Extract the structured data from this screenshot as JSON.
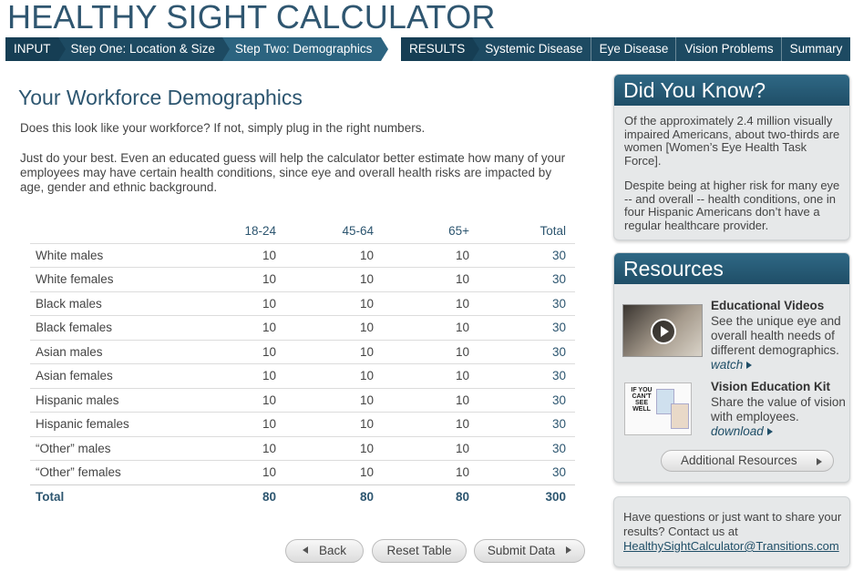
{
  "app_title": "HEALTHY SIGHT CALCULATOR",
  "nav": {
    "input_steps": [
      "INPUT",
      "Step One: Location & Size",
      "Step Two: Demographics"
    ],
    "result_steps": [
      "RESULTS",
      "Systemic Disease",
      "Eye Disease",
      "Vision Problems",
      "Summary"
    ],
    "active": "Step Two: Demographics"
  },
  "main": {
    "title": "Your Workforce Demographics",
    "intro_1": "Does this look like your workforce? If not, simply plug in the right numbers.",
    "intro_2": "Just do your best. Even an educated guess will help the calculator better estimate how many of your employees may have certain health conditions, since eye and overall health risks are impacted by age, gender and ethnic background."
  },
  "table": {
    "columns": [
      "",
      "18-24",
      "45-64",
      "65+",
      "Total"
    ],
    "rows": [
      {
        "label": "White males",
        "values": [
          "10",
          "10",
          "10"
        ],
        "total": "30"
      },
      {
        "label": "White females",
        "values": [
          "10",
          "10",
          "10"
        ],
        "total": "30"
      },
      {
        "label": "Black males",
        "values": [
          "10",
          "10",
          "10"
        ],
        "total": "30"
      },
      {
        "label": "Black females",
        "values": [
          "10",
          "10",
          "10"
        ],
        "total": "30"
      },
      {
        "label": "Asian males",
        "values": [
          "10",
          "10",
          "10"
        ],
        "total": "30"
      },
      {
        "label": "Asian females",
        "values": [
          "10",
          "10",
          "10"
        ],
        "total": "30"
      },
      {
        "label": "Hispanic males",
        "values": [
          "10",
          "10",
          "10"
        ],
        "total": "30"
      },
      {
        "label": "Hispanic females",
        "values": [
          "10",
          "10",
          "10"
        ],
        "total": "30"
      },
      {
        "label": "“Other” males",
        "values": [
          "10",
          "10",
          "10"
        ],
        "total": "30"
      },
      {
        "label": "“Other” females",
        "values": [
          "10",
          "10",
          "10"
        ],
        "total": "30"
      }
    ],
    "total_row": {
      "label": "Total",
      "values": [
        "80",
        "80",
        "80"
      ],
      "total": "300"
    }
  },
  "buttons": {
    "back": "Back",
    "reset": "Reset Table",
    "submit": "Submit Data"
  },
  "did_you_know": {
    "title": "Did You Know?",
    "p1": "Of the approximately 2.4 million visually impaired Americans, about two-thirds are women [Women’s Eye Health Task Force].",
    "p2": "Despite being at higher risk for many eye -- and overall -- health conditions, one in four Hispanic Americans don’t have a regular healthcare provider."
  },
  "resources": {
    "title": "Resources",
    "video": {
      "title": "Educational Videos",
      "desc": "See the unique eye and overall health needs of different demographics.",
      "link": "watch"
    },
    "kit": {
      "title": "Vision Education Kit",
      "desc": "Share the value of vision with employees.",
      "link": "download",
      "thumb_text": "IF YOU CAN'T SEE WELL"
    },
    "additional": "Additional Resources"
  },
  "contact": {
    "text": "Have questions or just want to share your results? Contact us at",
    "email": "HealthySightCalculator@Transitions.com"
  },
  "colors": {
    "brand_dark": "#1d4a62",
    "brand_active": "#2c6480",
    "title": "#2f5670",
    "panel": "#e6e8e9"
  }
}
